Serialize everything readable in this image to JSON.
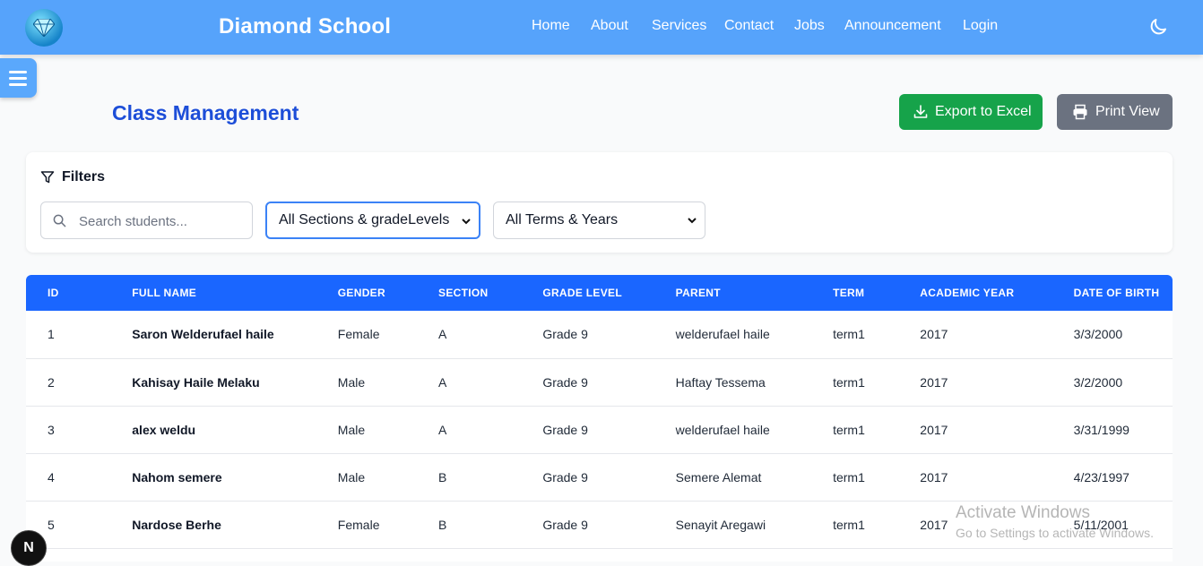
{
  "navbar": {
    "brand": "Diamond School",
    "links": [
      "Home",
      "About",
      "Services",
      "Contact",
      "Jobs",
      "Announcement",
      "Login"
    ],
    "theme_toggle_icon": "moon-icon",
    "logo_icon": "diamond-icon"
  },
  "sidebar_toggle_icon": "menu-icon",
  "page": {
    "title": "Class Management",
    "export_label": "Export to Excel",
    "print_label": "Print View"
  },
  "filters": {
    "title": "Filters",
    "search_placeholder": "Search students...",
    "section_select": "All Sections & gradeLevels",
    "term_select": "All Terms & Years"
  },
  "table": {
    "headers": [
      "ID",
      "FULL NAME",
      "GENDER",
      "SECTION",
      "GRADE LEVEL",
      "PARENT",
      "TERM",
      "ACADEMIC YEAR",
      "DATE OF BIRTH"
    ],
    "rows": [
      [
        "1",
        "Saron Welderufael haile",
        "Female",
        "A",
        "Grade 9",
        "welderufael haile",
        "term1",
        "2017",
        "3/3/2000"
      ],
      [
        "2",
        "Kahisay Haile Melaku",
        "Male",
        "A",
        "Grade 9",
        "Haftay Tessema",
        "term1",
        "2017",
        "3/2/2000"
      ],
      [
        "3",
        "alex weldu",
        "Male",
        "A",
        "Grade 9",
        "welderufael haile",
        "term1",
        "2017",
        "3/31/1999"
      ],
      [
        "4",
        "Nahom semere",
        "Male",
        "B",
        "Grade 9",
        "Semere Alemat",
        "term1",
        "2017",
        "4/23/1997"
      ],
      [
        "5",
        "Nardose Berhe",
        "Female",
        "B",
        "Grade 9",
        "Senayit Aregawi",
        "term1",
        "2017",
        "5/11/2001"
      ]
    ]
  },
  "overlay": {
    "watermark_title": "Activate Windows",
    "watermark_subtitle": "Go to Settings to activate Windows.",
    "dev_badge": "N"
  },
  "colors": {
    "navbar": "#56a3fb",
    "table_header": "#1a66ff",
    "export_button": "#16a34a",
    "print_button": "#6b7280",
    "title": "#1d4ed8"
  }
}
